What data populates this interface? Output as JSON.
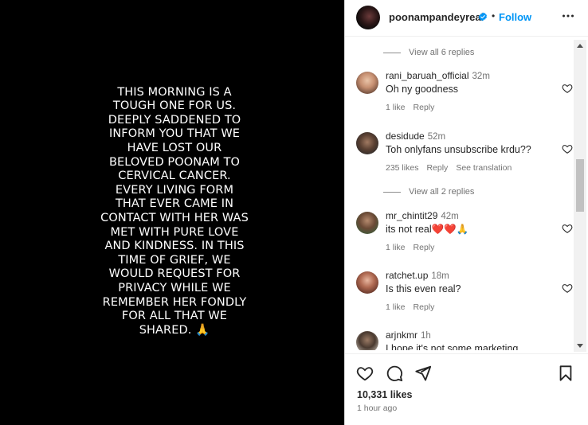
{
  "post": {
    "caption_lines": [
      "THIS MORNING IS A",
      "TOUGH ONE FOR US.",
      "DEEPLY SADDENED TO",
      "INFORM YOU THAT WE",
      "HAVE LOST OUR",
      "BELOVED POONAM TO",
      "CERVICAL CANCER.",
      "EVERY LIVING FORM",
      "THAT EVER CAME IN",
      "CONTACT WITH HER WAS",
      "MET WITH PURE LOVE",
      "AND KINDNESS. IN THIS",
      "TIME OF GRIEF, WE",
      "WOULD REQUEST FOR",
      "PRIVACY WHILE WE",
      "REMEMBER HER FONDLY",
      "FOR ALL THAT WE",
      "SHARED."
    ],
    "caption_emoji": "🙏"
  },
  "header": {
    "username": "poonampandeyreal",
    "separator": "•",
    "follow_label": "Follow"
  },
  "comments": {
    "view_replies_1": "View all 6 replies",
    "view_replies_2": "View all 2 replies",
    "items": [
      {
        "user": "rani_baruah_official",
        "time": "32m",
        "text": "Oh ny goodness",
        "likes": "1 like",
        "reply": "Reply",
        "translate": ""
      },
      {
        "user": "desidude",
        "time": "52m",
        "text": "Toh onlyfans unsubscribe krdu??",
        "likes": "235 likes",
        "reply": "Reply",
        "translate": "See translation"
      },
      {
        "user": "mr_chintit29",
        "time": "42m",
        "text": "its not real",
        "emoji": "❤️❤️🙏",
        "likes": "1 like",
        "reply": "Reply",
        "translate": ""
      },
      {
        "user": "ratchet.up",
        "time": "18m",
        "text": "Is this even real?",
        "likes": "1 like",
        "reply": "Reply",
        "translate": ""
      },
      {
        "user": "arjnkmr",
        "time": "1h",
        "text": "I hope it's not some marketing",
        "likes": "",
        "reply": "",
        "translate": ""
      }
    ]
  },
  "footer": {
    "likes": "10,331 likes",
    "time_ago": "1 hour ago"
  },
  "colors": {
    "accent": "#0095f6",
    "muted": "#737373",
    "text": "#262626"
  }
}
